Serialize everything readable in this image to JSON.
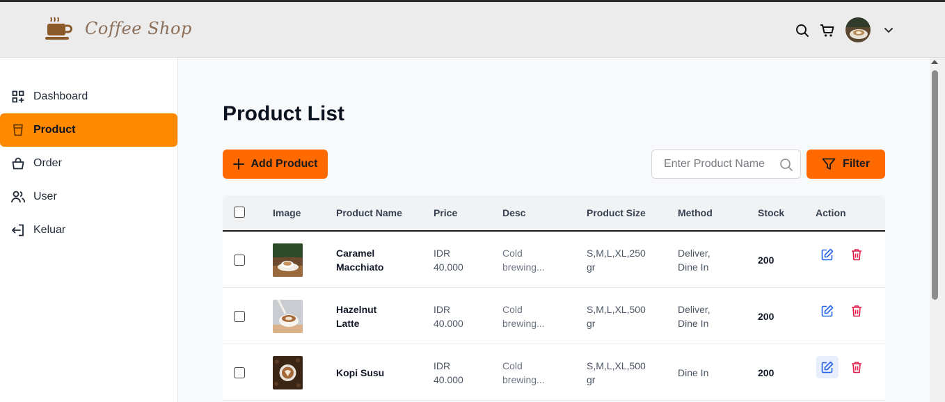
{
  "app": {
    "logo_text": "Coffee Shop"
  },
  "colors": {
    "accent": "#ff8a00",
    "button": "#ff6a00",
    "edit": "#2563eb",
    "delete": "#e11d48"
  },
  "header": {
    "icons": [
      "search-icon",
      "cart-icon",
      "avatar",
      "chevron-down-icon"
    ]
  },
  "sidebar": {
    "items": [
      {
        "label": "Dashboard",
        "icon": "dashboard-icon",
        "active": false
      },
      {
        "label": "Product",
        "icon": "cup-icon",
        "active": true
      },
      {
        "label": "Order",
        "icon": "bag-icon",
        "active": false
      },
      {
        "label": "User",
        "icon": "users-icon",
        "active": false
      },
      {
        "label": "Keluar",
        "icon": "logout-icon",
        "active": false
      }
    ]
  },
  "main": {
    "title": "Product List",
    "add_label": "Add Product",
    "search_placeholder": "Enter Product Name",
    "filter_label": "Filter"
  },
  "table": {
    "columns": [
      "Image",
      "Product Name",
      "Price",
      "Desc",
      "Product Size",
      "Method",
      "Stock",
      "Action"
    ],
    "rows": [
      {
        "name_l1": "Caramel",
        "name_l2": "Macchiato",
        "price_l1": "IDR",
        "price_l2": "40.000",
        "desc_l1": "Cold",
        "desc_l2": "brewing...",
        "size_l1": "S,M,L,XL,250",
        "size_l2": "gr",
        "method_l1": "Deliver,",
        "method_l2": "Dine In",
        "stock": "200"
      },
      {
        "name_l1": "Hazelnut",
        "name_l2": "Latte",
        "price_l1": "IDR",
        "price_l2": "40.000",
        "desc_l1": "Cold",
        "desc_l2": "brewing...",
        "size_l1": "S,M,L,XL,500",
        "size_l2": "gr",
        "method_l1": "Deliver,",
        "method_l2": "Dine In",
        "stock": "200"
      },
      {
        "name_l1": "Kopi Susu",
        "name_l2": "",
        "price_l1": "IDR",
        "price_l2": "40.000",
        "desc_l1": "Cold",
        "desc_l2": "brewing...",
        "size_l1": "S,M,L,XL,500",
        "size_l2": "gr",
        "method_l1": "Dine In",
        "method_l2": "",
        "stock": "200"
      }
    ]
  }
}
